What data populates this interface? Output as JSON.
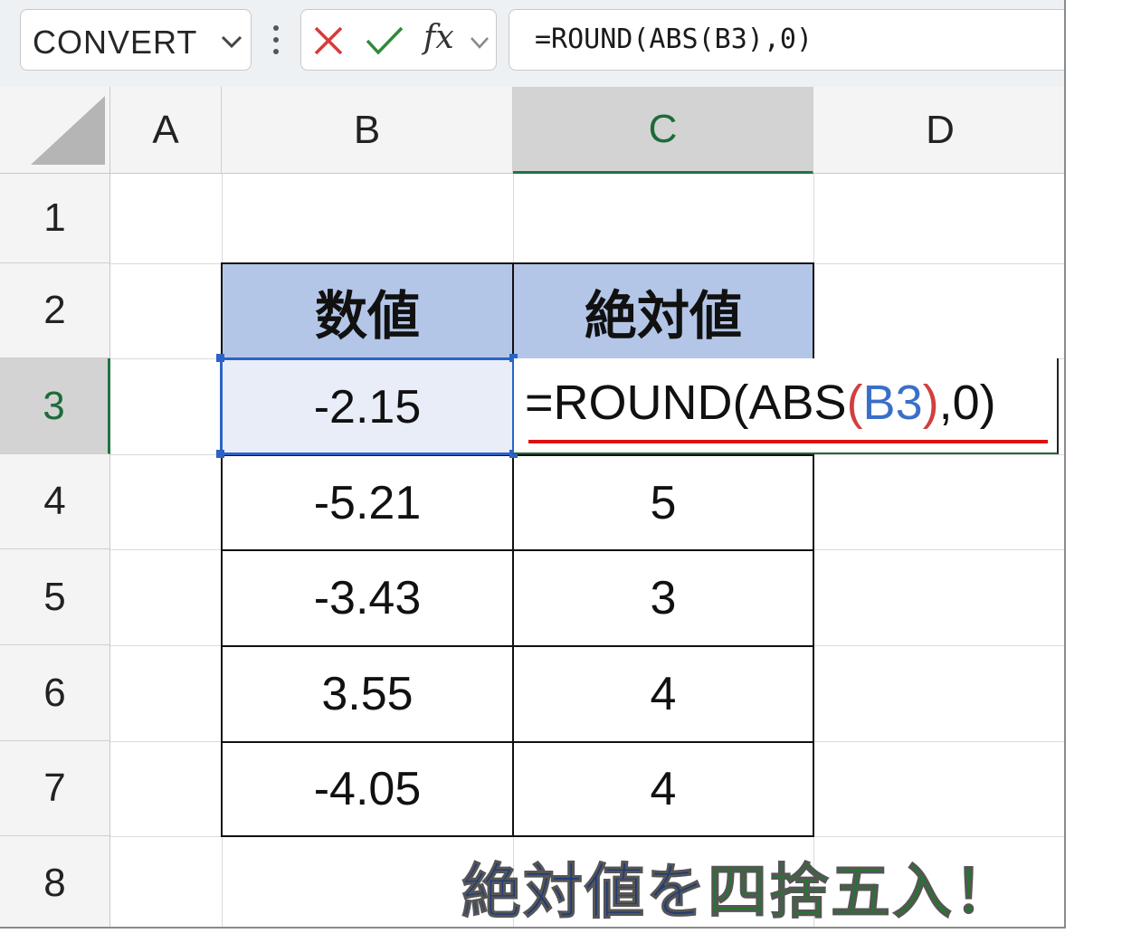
{
  "name_box": {
    "value": "CONVERT"
  },
  "formula_bar": {
    "fx_label": "fx",
    "formula": "=ROUND(ABS(B3),0)"
  },
  "columns": [
    "A",
    "B",
    "C",
    "D"
  ],
  "rows": [
    "1",
    "2",
    "3",
    "4",
    "5",
    "6",
    "7",
    "8"
  ],
  "table": {
    "headers": [
      "数値",
      "絶対値"
    ],
    "rows": [
      [
        "-2.15",
        ""
      ],
      [
        "-5.21",
        "5"
      ],
      [
        "-3.43",
        "3"
      ],
      [
        "3.55",
        "4"
      ],
      [
        "-4.05",
        "4"
      ]
    ]
  },
  "edit_cell": {
    "prefix": "=ROUND(ABS",
    "open_paren": "(",
    "ref": "B3",
    "close_paren": ")",
    "suffix": ",0)"
  },
  "caption": {
    "part1": "絶対値を",
    "part2": "四捨五入！"
  },
  "colors": {
    "accent_green": "#217346",
    "header_fill": "#b4c6e7",
    "selection_blue": "#2b63c6",
    "underline_red": "#e01010"
  }
}
